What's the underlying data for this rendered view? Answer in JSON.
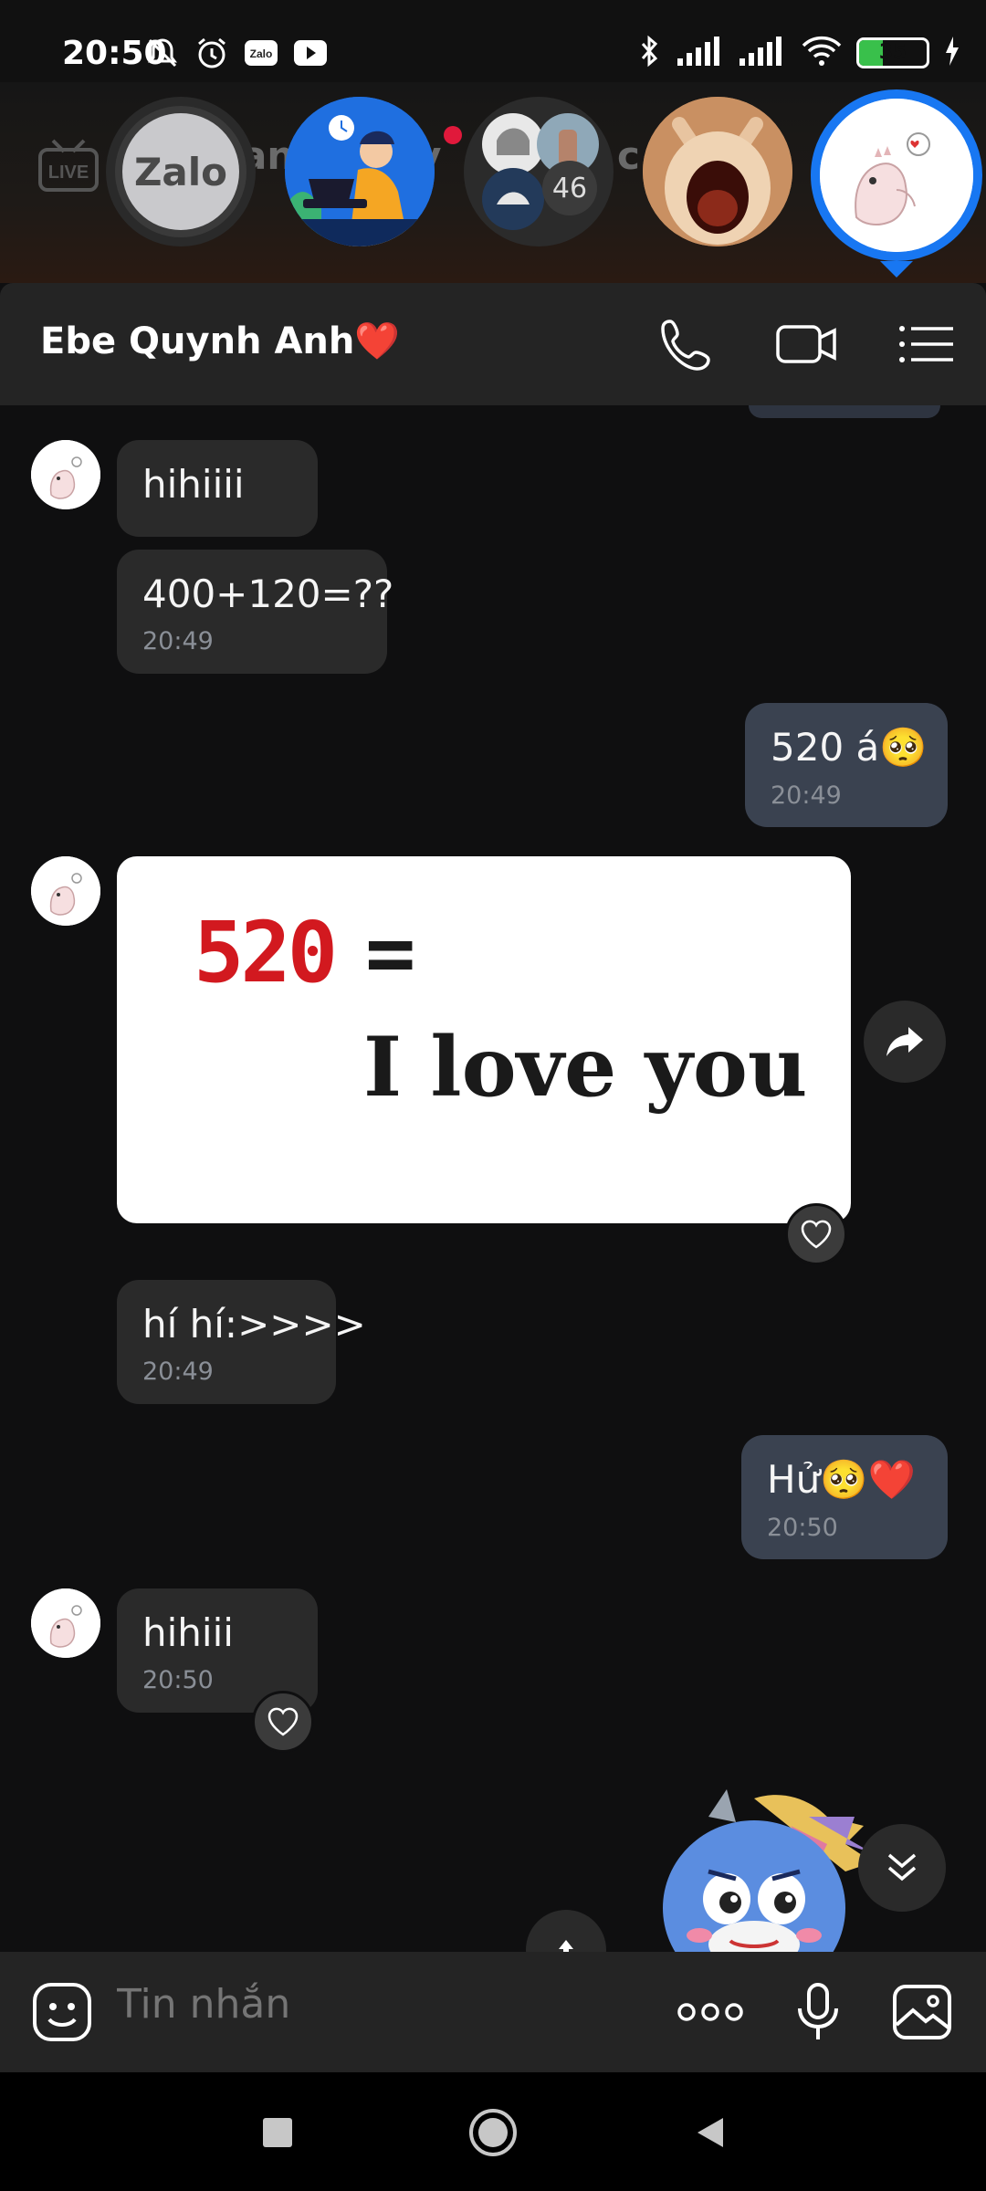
{
  "status_bar": {
    "time": "20:50",
    "battery": "35",
    "battery_level": 0.35,
    "left_icons": [
      "mute-bell-icon",
      "alarm-icon",
      "zalo-notification-icon",
      "youtube-icon"
    ],
    "right_icons": [
      "bluetooth-icon",
      "signal-icon",
      "signal-icon",
      "wifi-icon",
      "battery-icon",
      "charging-icon"
    ]
  },
  "bubble_heads": {
    "zalo_label": "Zalo",
    "group_count": "46",
    "active_color": "#1877f2"
  },
  "header": {
    "title": "Ebe Quynh Anh❤️",
    "icons": [
      "phone-icon",
      "video-call-icon",
      "menu-list-icon"
    ]
  },
  "messages": [
    {
      "direction": "in",
      "text": "hihiiii",
      "time": ""
    },
    {
      "direction": "in",
      "text": "400+120=??",
      "time": "20:49"
    },
    {
      "direction": "out",
      "text": "520 á🥺",
      "time": "20:49"
    },
    {
      "direction": "in",
      "type": "image",
      "image_text": {
        "number": "520",
        "equals": "=",
        "phrase": "I love you"
      }
    },
    {
      "direction": "in",
      "text": "hí hí:>>>>",
      "time": "20:49"
    },
    {
      "direction": "out",
      "text": "Hử🥺❤️",
      "time": "20:50"
    },
    {
      "direction": "in",
      "text": "hihiii",
      "time": "20:50"
    }
  ],
  "input_bar": {
    "placeholder": "Tin nhắn",
    "icons": [
      "emoji-sticker-icon",
      "more-options-icon",
      "microphone-icon",
      "image-gallery-icon"
    ]
  },
  "nav_bar": {
    "icons": [
      "recent-apps-icon",
      "home-icon",
      "back-icon"
    ]
  },
  "colors": {
    "background": "#0f0f10",
    "incoming_bubble": "#2a2a2a",
    "outgoing_bubble": "#3a4250",
    "accent": "#1877f2",
    "heart_red": "#e0193b"
  }
}
